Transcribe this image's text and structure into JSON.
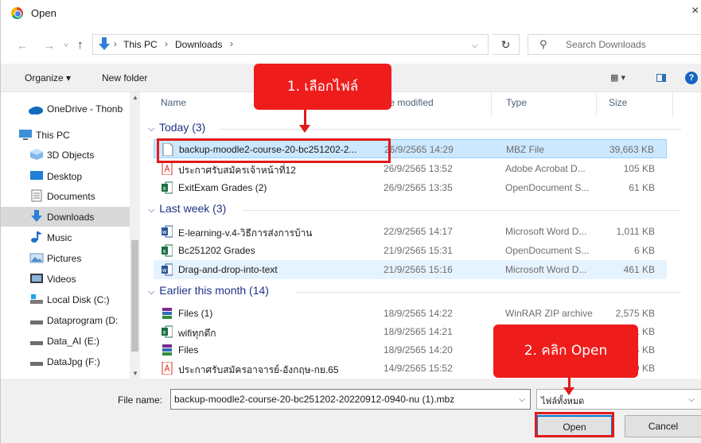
{
  "window": {
    "title": "Open",
    "close": "×"
  },
  "address": {
    "back": "←",
    "forward": "→",
    "history": "˅",
    "up": "↑",
    "crumbs": [
      "This PC",
      "Downloads"
    ],
    "sep": "›",
    "dropdown": "⌵",
    "refresh": "↻",
    "search_icon": "⚲",
    "search_placeholder": "Search Downloads"
  },
  "toolbar": {
    "organize": "Organize ▾",
    "new_folder": "New folder",
    "view": "▦ ▾",
    "help": "?"
  },
  "sidebar": {
    "items": [
      {
        "label": "OneDrive - Thonb",
        "icon": "onedrive-icon"
      },
      {
        "label": "This PC",
        "icon": "computer-icon"
      },
      {
        "label": "3D Objects",
        "icon": "3d-objects-icon"
      },
      {
        "label": "Desktop",
        "icon": "desktop-icon"
      },
      {
        "label": "Documents",
        "icon": "documents-icon"
      },
      {
        "label": "Downloads",
        "icon": "downloads-icon"
      },
      {
        "label": "Music",
        "icon": "music-icon"
      },
      {
        "label": "Pictures",
        "icon": "pictures-icon"
      },
      {
        "label": "Videos",
        "icon": "videos-icon"
      },
      {
        "label": "Local Disk (C:)",
        "icon": "local-disk-icon"
      },
      {
        "label": "Dataprogram (D:",
        "icon": "drive-icon"
      },
      {
        "label": "Data_AI (E:)",
        "icon": "drive-icon"
      },
      {
        "label": "DataJpg (F:)",
        "icon": "drive-icon"
      }
    ]
  },
  "columns": {
    "name": "Name",
    "date": "te modified",
    "type": "Type",
    "size": "Size"
  },
  "groups": [
    {
      "label": "Today (3)",
      "chevron": "⌵"
    },
    {
      "label": "Last week (3)",
      "chevron": "⌵"
    },
    {
      "label": "Earlier this month (14)",
      "chevron": "⌵"
    }
  ],
  "files": [
    {
      "name": "backup-moodle2-course-20-bc251202-2...",
      "date": "26/9/2565 14:29",
      "type": "MBZ File",
      "size": "39,663 KB",
      "icon": "mbz-file-icon"
    },
    {
      "name": "ประกาศรับสมัครเจ้าหน้าที่12",
      "date": "26/9/2565 13:52",
      "type": "Adobe Acrobat D...",
      "size": "105 KB",
      "icon": "pdf-icon"
    },
    {
      "name": "ExitExam Grades (2)",
      "date": "26/9/2565 13:35",
      "type": "OpenDocument S...",
      "size": "61 KB",
      "icon": "spreadsheet-icon"
    },
    {
      "name": "E-learning-v.4-วิธีการส่งการบ้าน",
      "date": "22/9/2565 14:17",
      "type": "Microsoft Word D...",
      "size": "1,011 KB",
      "icon": "word-icon"
    },
    {
      "name": "Bc251202 Grades",
      "date": "21/9/2565 15:31",
      "type": "OpenDocument S...",
      "size": "6 KB",
      "icon": "spreadsheet-icon"
    },
    {
      "name": "Drag-and-drop-into-text",
      "date": "21/9/2565 15:16",
      "type": "Microsoft Word D...",
      "size": "461 KB",
      "icon": "word-icon"
    },
    {
      "name": "Files (1)",
      "date": "18/9/2565 14:22",
      "type": "WinRAR ZIP archive",
      "size": "2,575 KB",
      "icon": "winrar-icon"
    },
    {
      "name": "wifiทุกตึก",
      "date": "18/9/2565 14:21",
      "type": "",
      "size": "11 KB",
      "icon": "spreadsheet-icon"
    },
    {
      "name": "Files",
      "date": "18/9/2565 14:20",
      "type": "",
      "size": "24 KB",
      "icon": "winrar-icon"
    },
    {
      "name": "ประกาศรับสมัครอาจารย์-อังกฤษ-กย.65",
      "date": "14/9/2565 15:52",
      "type": "",
      "size": "29 KB",
      "icon": "pdf-icon"
    }
  ],
  "bottom": {
    "filename_label": "File name:",
    "filename_value": "backup-moodle2-course-20-bc251202-20220912-0940-nu (1).mbz",
    "filetype_value": "ไฟล์ทั้งหมด",
    "open": "Open",
    "cancel": "Cancel"
  },
  "annotations": {
    "step1": "1. เลือกไฟล์",
    "step2": "2. คลิก Open"
  },
  "colors": {
    "annotation": "#ef1c1c",
    "selection": "#cce8ff",
    "group_heading": "#1e3287"
  }
}
